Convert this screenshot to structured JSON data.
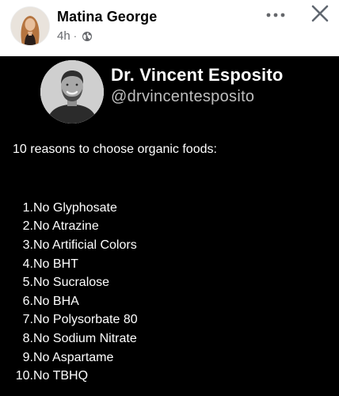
{
  "post": {
    "author": "Matina George",
    "time": "4h",
    "separator": "·",
    "audience_icon": "globe-icon",
    "more_icon": "more-horizontal-icon",
    "close_icon": "close-icon"
  },
  "card": {
    "name": "Dr. Vincent Esposito",
    "handle": "@drvincentesposito",
    "intro": "10 reasons to choose organic foods:",
    "reasons": [
      {
        "num": "1.",
        "text": "No Glyphosate"
      },
      {
        "num": "2.",
        "text": "No Atrazine"
      },
      {
        "num": "3.",
        "text": "No Artificial Colors"
      },
      {
        "num": "4.",
        "text": "No BHT"
      },
      {
        "num": "5.",
        "text": "No Sucralose"
      },
      {
        "num": "6.",
        "text": "No BHA"
      },
      {
        "num": "7.",
        "text": "No Polysorbate 80"
      },
      {
        "num": "8.",
        "text": "No Sodium Nitrate"
      },
      {
        "num": "9.",
        "text": "No Aspartame"
      },
      {
        "num": "10.",
        "text": "No TBHQ"
      }
    ]
  },
  "colors": {
    "header_bg": "#ffffff",
    "name_text": "#050505",
    "meta_text": "#65676b",
    "card_bg": "#000000",
    "card_text": "#ffffff",
    "handle_text": "#bfbfbf"
  }
}
